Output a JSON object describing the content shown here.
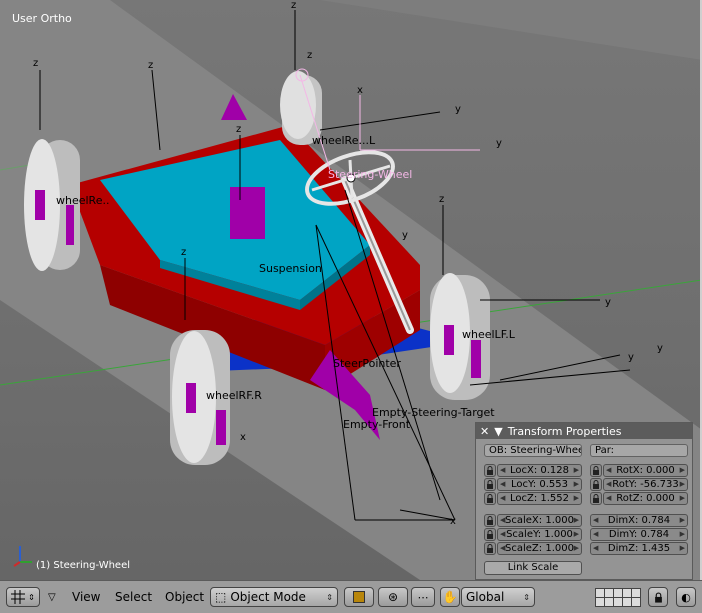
{
  "viewport": {
    "view_label": "User Ortho",
    "active_object_label": "(1) Steering-Wheel"
  },
  "scene_labels": {
    "wheel_rear_left": "wheelRe..",
    "wheel_right_front": "wheelRF.R",
    "wheel_left_front": "wheelLF.L",
    "wheel_rear_top": "wheelRe...L",
    "suspension": "Suspension",
    "steering_wheel": "Steering-Wheel",
    "steer_pointer": "SteerPointer",
    "empty_steering_target": "Empty-Steering-Target",
    "empty_front": "Empty-Front"
  },
  "axis_letters": {
    "z": "z",
    "y": "y",
    "x": "x"
  },
  "transform_panel": {
    "title": "Transform Properties",
    "object_field": "OB: Steering-Wheel",
    "parent_field": "Par:",
    "loc": [
      {
        "label": "LocX: 0.128"
      },
      {
        "label": "LocY: 0.553"
      },
      {
        "label": "LocZ: 1.552"
      }
    ],
    "rot": [
      {
        "label": "RotX: 0.000"
      },
      {
        "label": "RotY: -56.733"
      },
      {
        "label": "RotZ: 0.000"
      }
    ],
    "scale": [
      {
        "label": "ScaleX: 1.000"
      },
      {
        "label": "ScaleY: 1.000"
      },
      {
        "label": "ScaleZ: 1.000"
      }
    ],
    "dim": [
      {
        "label": "DimX: 0.784"
      },
      {
        "label": "DimY: 0.784"
      },
      {
        "label": "DimZ: 1.435"
      }
    ],
    "link_scale": "Link Scale"
  },
  "header": {
    "menus": {
      "view": "View",
      "select": "Select",
      "object": "Object"
    },
    "mode": "Object Mode",
    "orientation": "Global"
  },
  "colors": {
    "chassis": "#b50000",
    "top_plate": "#00a4c4",
    "bottom_plate": "#0b32c8",
    "bone_magenta": "#a000a8",
    "wheel": "#dcdcdc",
    "selection": "#f3a6e8"
  },
  "icons": [
    "grid-icon",
    "collapse-triangle-icon",
    "object-mode-icon",
    "draw-type-icon",
    "pivot-icon",
    "snap-icon",
    "hand-icon",
    "lock-icon",
    "render-icon",
    "close-x-icon",
    "arrow-down-icon"
  ]
}
